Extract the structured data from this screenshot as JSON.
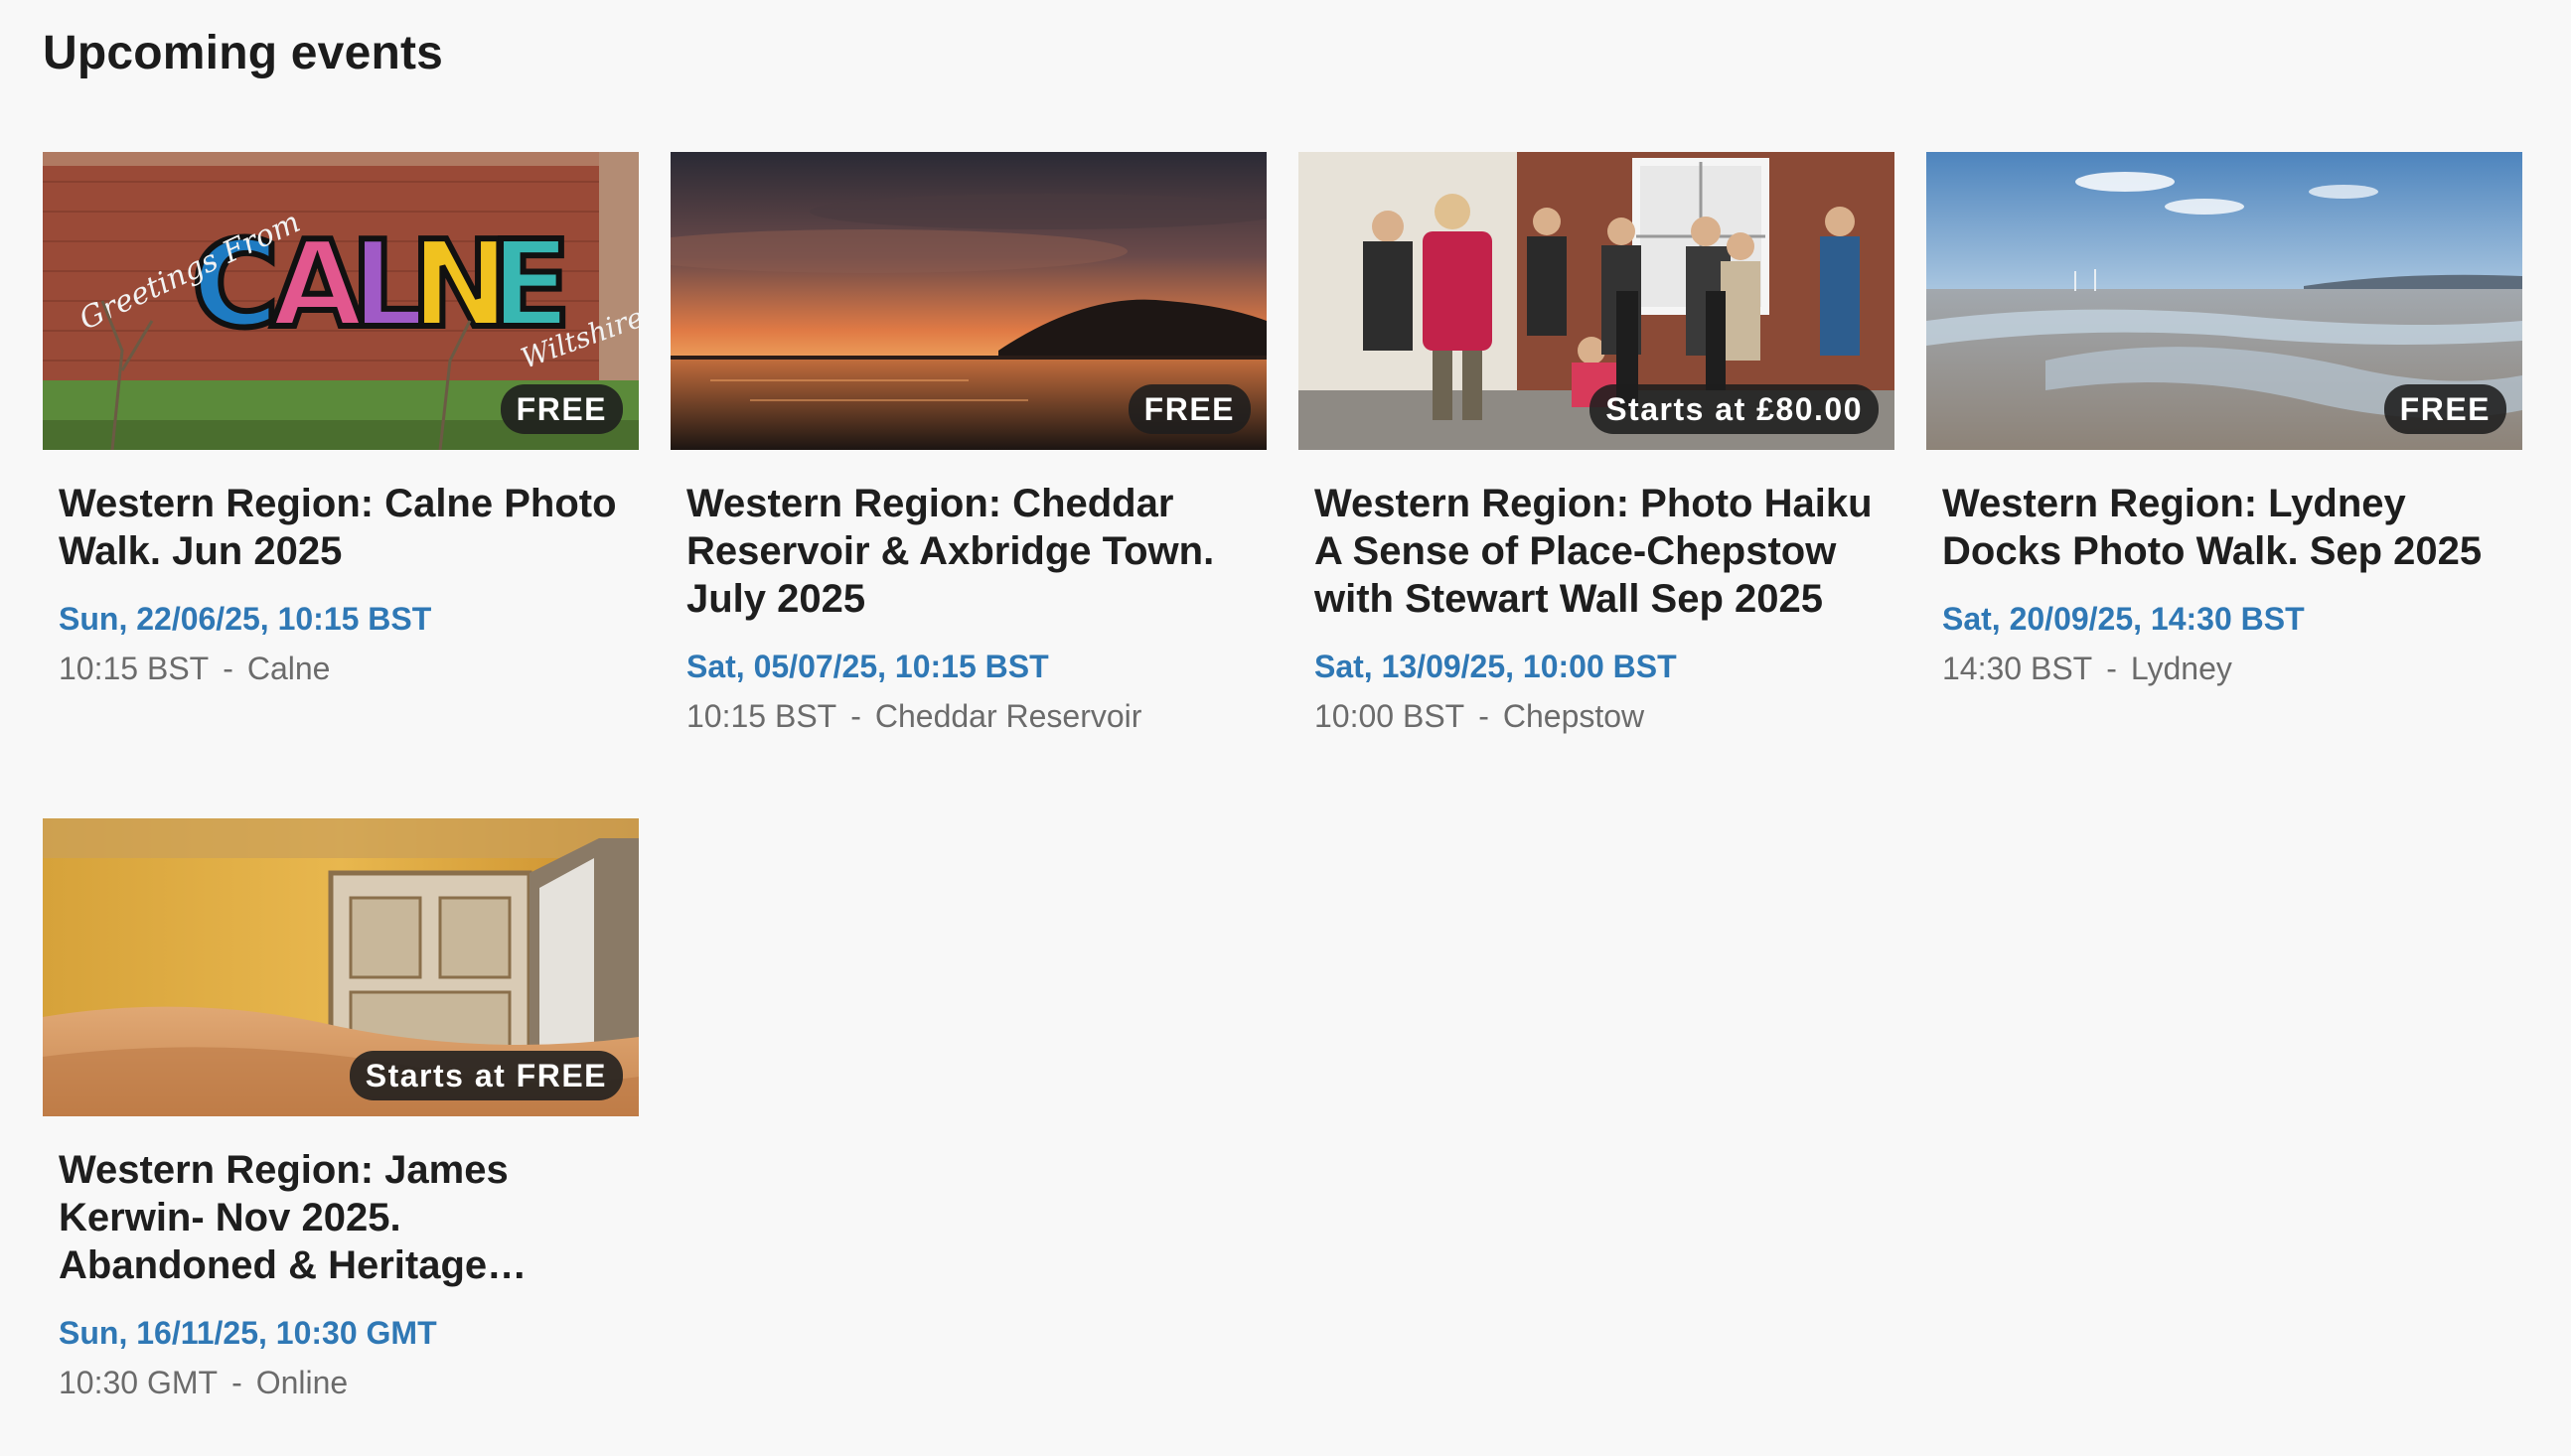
{
  "section": {
    "title": "Upcoming events"
  },
  "events": [
    {
      "title": "Western Region: Calne Photo Walk. Jun 2025",
      "badge": "FREE",
      "date": "Sun, 22/06/25, 10:15 BST",
      "time": "10:15 BST",
      "separator": "-",
      "location": "Calne",
      "image_icon": "calne-mural-image"
    },
    {
      "title": "Western Region: Cheddar Reservoir & Axbridge Town. July 2025",
      "badge": "FREE",
      "date": "Sat, 05/07/25, 10:15 BST",
      "time": "10:15 BST",
      "separator": "-",
      "location": "Cheddar Reservoir",
      "image_icon": "sunset-reservoir-image"
    },
    {
      "title": "Western Region: Photo Haiku A Sense of Place-Chepstow with Stewart Wall Sep 2025",
      "badge": "Starts at £80.00",
      "date": "Sat, 13/09/25, 10:00 BST",
      "time": "10:00 BST",
      "separator": "-",
      "location": "Chepstow",
      "image_icon": "photographers-street-image"
    },
    {
      "title": "Western Region: Lydney Docks Photo Walk. Sep 2025",
      "badge": "FREE",
      "date": "Sat, 20/09/25, 14:30 BST",
      "time": "14:30 BST",
      "separator": "-",
      "location": "Lydney",
      "image_icon": "tidal-estuary-image"
    },
    {
      "title": "Western Region: James Kerwin- Nov 2025. Abandoned & Heritage…",
      "badge": "Starts at FREE",
      "date": "Sun, 16/11/25, 10:30 GMT",
      "time": "10:30 GMT",
      "separator": "-",
      "location": "Online",
      "image_icon": "abandoned-sand-room-image"
    }
  ],
  "colors": {
    "date_blue": "#2f78b5",
    "meta_grey": "#6b6b6b",
    "background": "#f8f8f8"
  }
}
